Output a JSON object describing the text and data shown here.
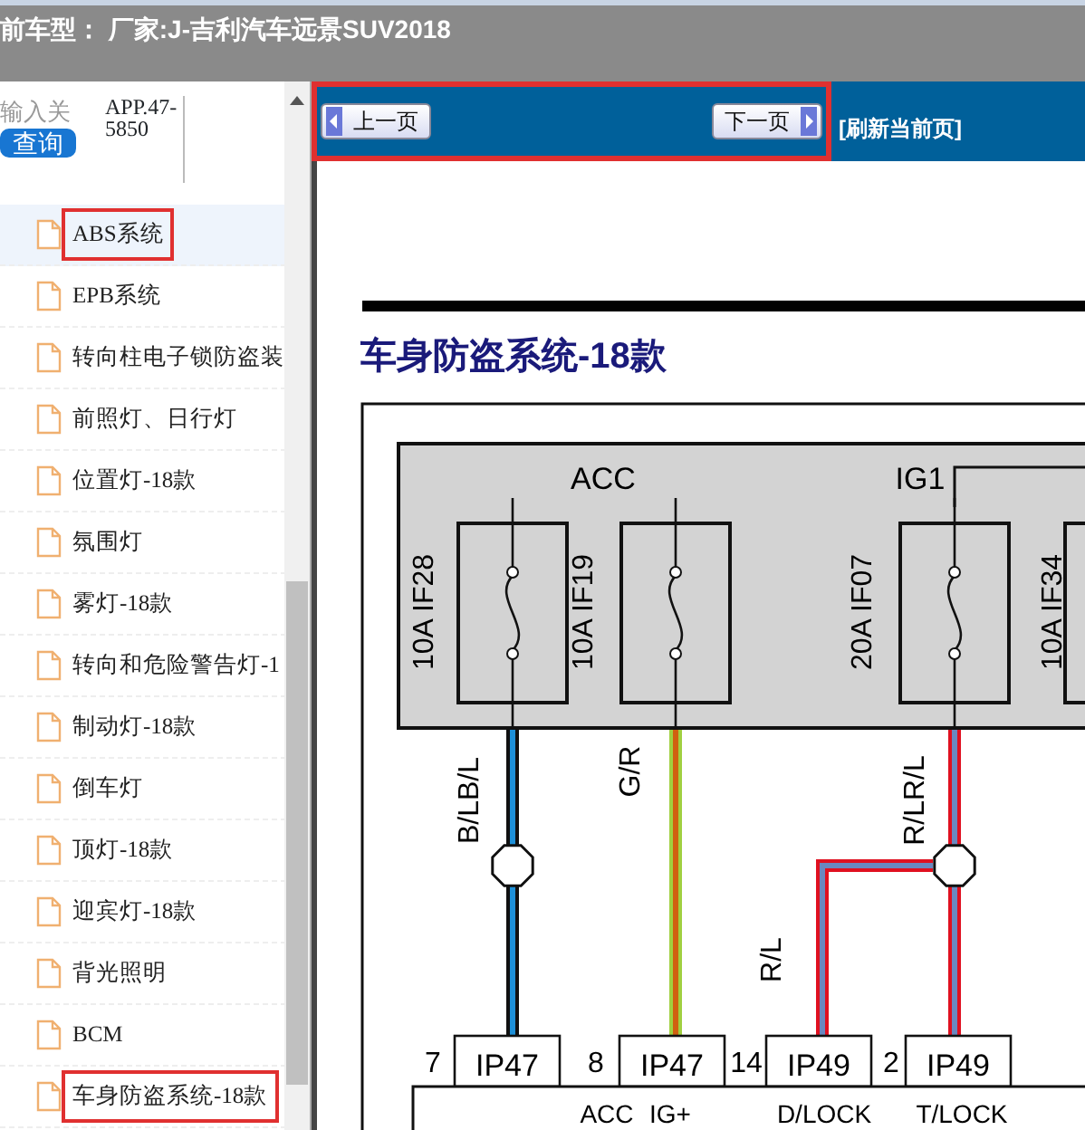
{
  "header": {
    "title": "前车型：  厂家:J-吉利汽车远景SUV2018"
  },
  "sidebar": {
    "search": {
      "placeholder": "输入关",
      "button": "查询"
    },
    "code": "APP.47-5850",
    "items": [
      {
        "label": "ABS系统",
        "selected": true,
        "marked": true
      },
      {
        "label": "EPB系统",
        "selected": false,
        "marked": false
      },
      {
        "label": "转向柱电子锁防盗装",
        "selected": false,
        "marked": false
      },
      {
        "label": "前照灯、日行灯",
        "selected": false,
        "marked": false
      },
      {
        "label": "位置灯-18款",
        "selected": false,
        "marked": false
      },
      {
        "label": "氛围灯",
        "selected": false,
        "marked": false
      },
      {
        "label": "雾灯-18款",
        "selected": false,
        "marked": false
      },
      {
        "label": "转向和危险警告灯-1",
        "selected": false,
        "marked": false
      },
      {
        "label": "制动灯-18款",
        "selected": false,
        "marked": false
      },
      {
        "label": "倒车灯",
        "selected": false,
        "marked": false
      },
      {
        "label": "顶灯-18款",
        "selected": false,
        "marked": false
      },
      {
        "label": "迎宾灯-18款",
        "selected": false,
        "marked": false
      },
      {
        "label": "背光照明",
        "selected": false,
        "marked": false
      },
      {
        "label": "BCM",
        "selected": false,
        "marked": false
      },
      {
        "label": "车身防盗系统-18款",
        "selected": false,
        "marked": true
      }
    ]
  },
  "toolbar": {
    "prev": "上一页",
    "next": "下一页",
    "refresh": "[刷新当前页]",
    "marked": true
  },
  "diagram": {
    "title": "车身防盗系统-18款",
    "power_labels": [
      "ACC",
      "IG1"
    ],
    "fuses": [
      {
        "rating": "10A",
        "id": "IF28"
      },
      {
        "rating": "10A",
        "id": "IF19"
      },
      {
        "rating": "20A",
        "id": "IF07"
      },
      {
        "rating": "10A",
        "id": "IF34"
      }
    ],
    "wires": [
      "B/LB/L",
      "G/R",
      "R/LR/L",
      "R/L"
    ],
    "connectors": [
      {
        "pin": "7",
        "name": "IP47"
      },
      {
        "pin": "8",
        "name": "IP47"
      },
      {
        "pin": "14",
        "name": "IP49"
      },
      {
        "pin": "2",
        "name": "IP49"
      }
    ],
    "module_labels": [
      "ACC",
      "IG+",
      "D/LOCK",
      "T/LOCK"
    ]
  }
}
